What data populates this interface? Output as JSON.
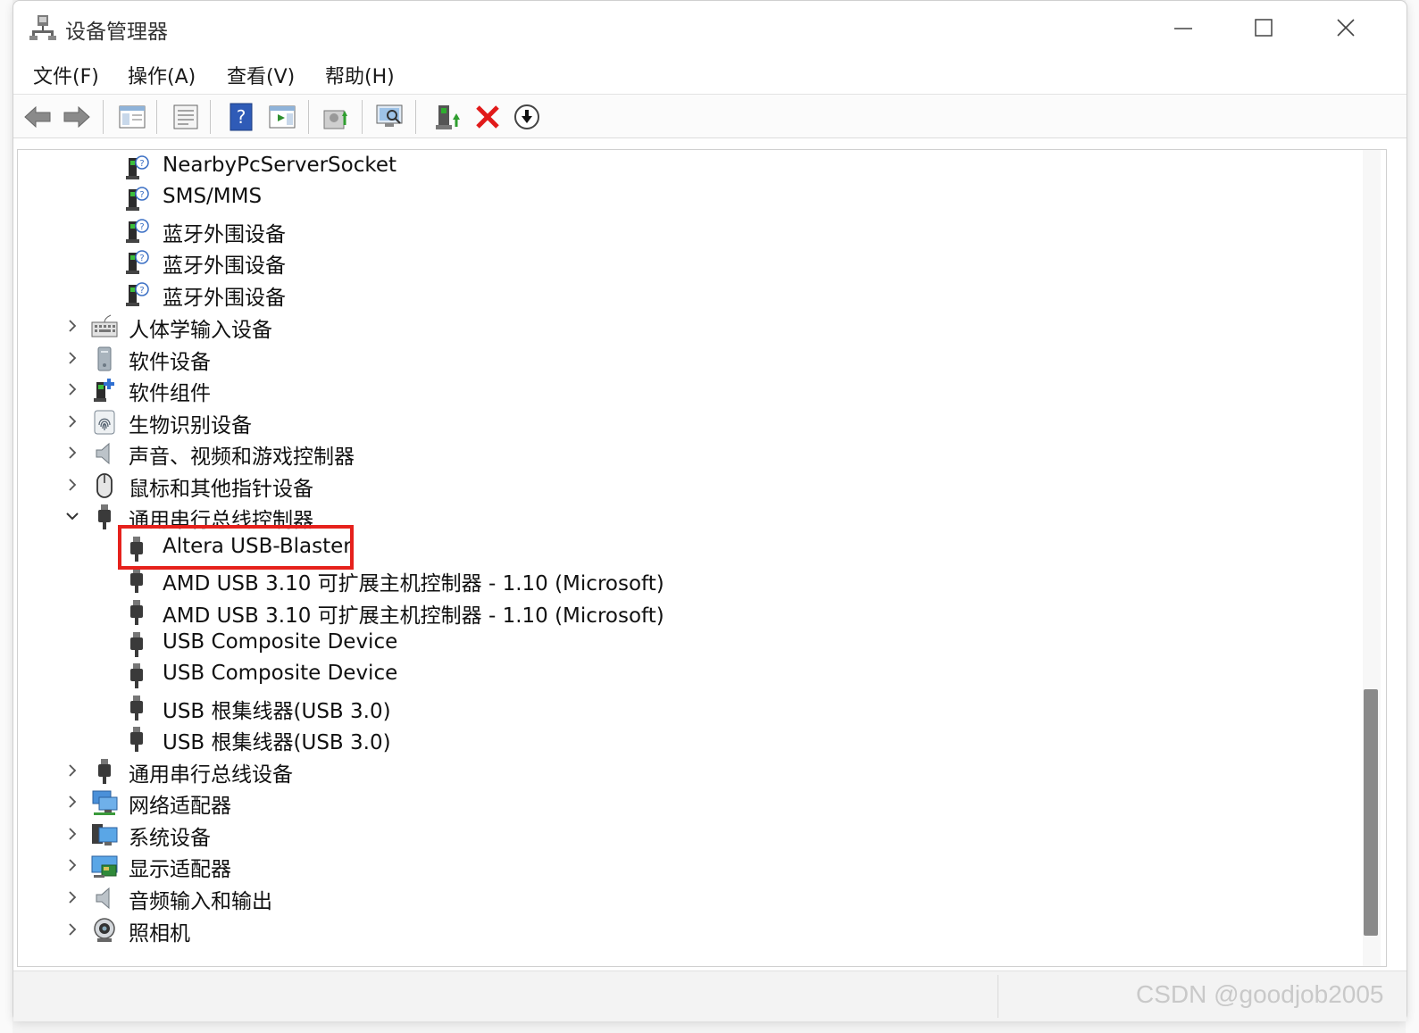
{
  "window": {
    "title": "设备管理器"
  },
  "menu": [
    "文件(F)",
    "操作(A)",
    "查看(V)",
    "帮助(H)"
  ],
  "toolbar": {
    "icons": [
      "back-arrow-icon",
      "forward-arrow-icon",
      "show-hide-console-tree-icon",
      "properties-icon",
      "help-icon",
      "action-pane-icon",
      "update-driver-icon",
      "scan-hardware-icon",
      "enable-device-icon",
      "uninstall-device-icon",
      "disable-device-icon"
    ]
  },
  "tree": {
    "bluetooth_children": [
      "NearbyPcServerSocket",
      "SMS/MMS",
      "蓝牙外围设备",
      "蓝牙外围设备",
      "蓝牙外围设备"
    ],
    "categories_a": [
      "人体学输入设备",
      "软件设备",
      "软件组件",
      "生物识别设备",
      "声音、视频和游戏控制器",
      "鼠标和其他指针设备"
    ],
    "usb_controllers": {
      "label": "通用串行总线控制器",
      "children": [
        "Altera USB-Blaster",
        "AMD USB 3.10 可扩展主机控制器 - 1.10 (Microsoft)",
        "AMD USB 3.10 可扩展主机控制器 - 1.10 (Microsoft)",
        "USB Composite Device",
        "USB Composite Device",
        "USB 根集线器(USB 3.0)",
        "USB 根集线器(USB 3.0)"
      ]
    },
    "categories_b": [
      "通用串行总线设备",
      "网络适配器",
      "系统设备",
      "显示适配器",
      "音频输入和输出",
      "照相机"
    ]
  },
  "colors": {
    "highlight": "#e6211c",
    "scrollbar": "#8a8a8a"
  },
  "watermark": "CSDN @goodjob2005"
}
